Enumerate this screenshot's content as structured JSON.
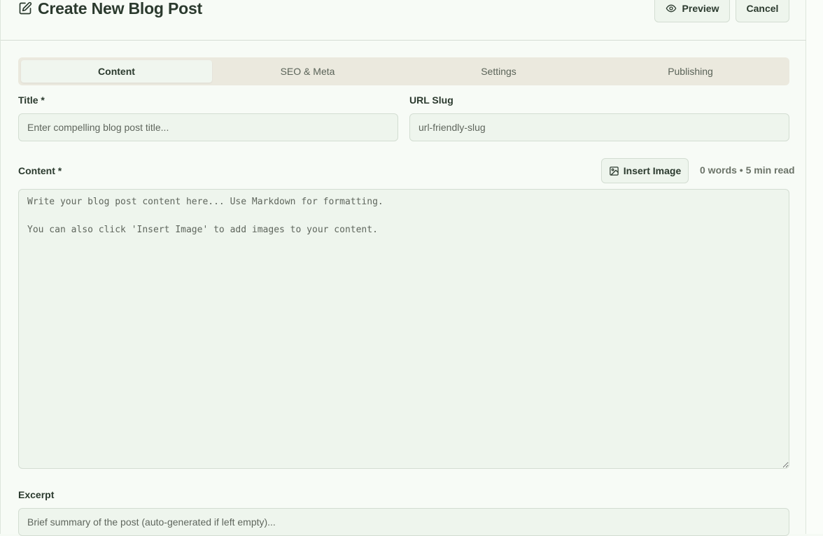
{
  "header": {
    "title": "Create New Blog Post",
    "title_icon": "edit-icon",
    "preview_label": "Preview",
    "preview_icon": "eye-icon",
    "cancel_label": "Cancel"
  },
  "tabs": [
    {
      "label": "Content",
      "active": true
    },
    {
      "label": "SEO & Meta",
      "active": false
    },
    {
      "label": "Settings",
      "active": false
    },
    {
      "label": "Publishing",
      "active": false
    }
  ],
  "form": {
    "title_label": "Title *",
    "title_placeholder": "Enter compelling blog post title...",
    "title_value": "",
    "slug_label": "URL Slug",
    "slug_placeholder": "url-friendly-slug",
    "slug_value": "",
    "content_label": "Content *",
    "insert_image_label": "Insert Image",
    "insert_image_icon": "image-icon",
    "word_count": "0 words • 5 min read",
    "content_placeholder": "Write your blog post content here... Use Markdown for formatting.\n\nYou can also click 'Insert Image' to add images to your content.",
    "content_value": "",
    "excerpt_label": "Excerpt",
    "excerpt_placeholder": "Brief summary of the post (auto-generated if left empty)...",
    "excerpt_value": ""
  },
  "colors": {
    "background": "#f7fbf6",
    "field_background": "#eef5ed",
    "tabs_background": "#ebe9de",
    "border": "#d3ddd2",
    "text": "#2b3a2e",
    "muted_text": "#6b7368"
  }
}
